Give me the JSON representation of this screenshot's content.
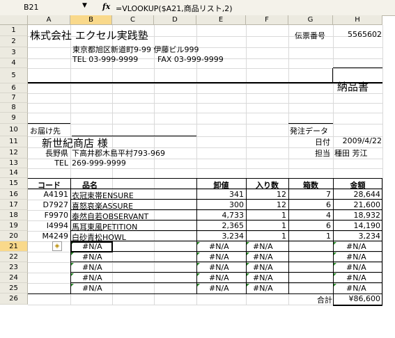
{
  "formula_bar": {
    "name_box": "B21",
    "dropdown": "▼",
    "fx": "fx",
    "formula": "=VLOOKUP($A21,商品リスト,2)"
  },
  "columns": [
    "A",
    "B",
    "C",
    "D",
    "E",
    "F",
    "G",
    "H"
  ],
  "rows": [
    "1",
    "2",
    "3",
    "4",
    "5",
    "6",
    "7",
    "8",
    "9",
    "10",
    "11",
    "12",
    "13",
    "14",
    "15",
    "16",
    "17",
    "18",
    "19",
    "20",
    "21",
    "22",
    "23",
    "24",
    "25",
    "26"
  ],
  "header": {
    "company": "株式会社 エクセル実践塾",
    "address": "東京都旭区新道町9-99 伊藤ビル999",
    "tel": "TEL 03-999-9999",
    "fax": "FAX 03-999-9999",
    "slip_label": "伝票番号",
    "slip_number": "5565602",
    "doc_title": "納品書"
  },
  "delivery": {
    "to_label": "お届け先",
    "customer": "新世紀商店 様",
    "cust_address_pref": "長野県",
    "cust_address": "下高井郡木島平村793-969",
    "cust_tel_label": "TEL",
    "cust_tel": "269-999-9999",
    "order_label": "発注データ",
    "date_label": "日付",
    "date": "2009/4/22",
    "staff_label": "担当",
    "staff": "種田 芳江"
  },
  "table": {
    "headers": [
      "コード",
      "品名",
      "卸値",
      "入り数",
      "箱数",
      "金額"
    ],
    "rows": [
      {
        "code": "A4191",
        "name": "衣冠束帯ENSURE",
        "price": "341",
        "qty": "12",
        "boxes": "7",
        "amount": "28,644"
      },
      {
        "code": "D7927",
        "name": "喜怒哀楽ASSURE",
        "price": "300",
        "qty": "12",
        "boxes": "6",
        "amount": "21,600"
      },
      {
        "code": "F9970",
        "name": "泰然自若OBSERVANT",
        "price": "4,733",
        "qty": "1",
        "boxes": "4",
        "amount": "18,932"
      },
      {
        "code": "I4994",
        "name": "馬耳東風PETITION",
        "price": "2,365",
        "qty": "1",
        "boxes": "6",
        "amount": "14,190"
      },
      {
        "code": "M4249",
        "name": "白砂青松HOWL",
        "price": "3,234",
        "qty": "1",
        "boxes": "1",
        "amount": "3,234"
      }
    ],
    "error_value": "#N/A",
    "total_label": "合計",
    "total_value": "¥86,600"
  },
  "colors": {
    "header_bg": "#eceae0",
    "selected_header": "#f9d98b",
    "error_triangle": "#2a8a2a",
    "warn_icon": "#f5c400"
  },
  "icons": {
    "error_check": "warning-diamond-icon"
  }
}
